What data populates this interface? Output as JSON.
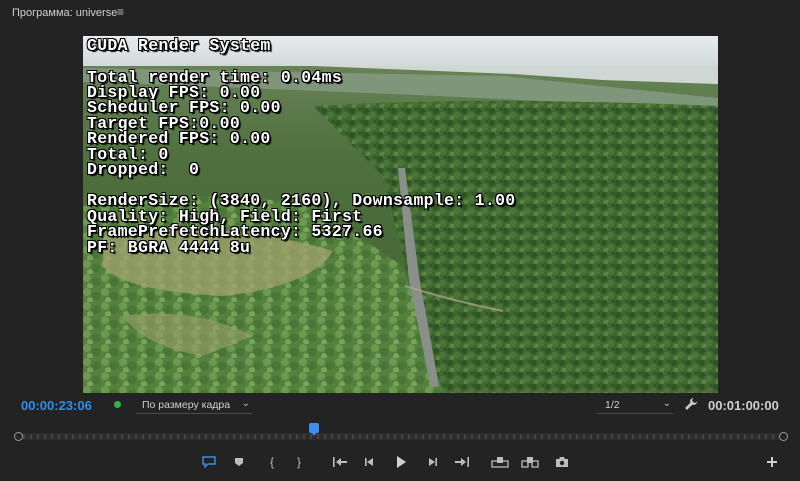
{
  "panel": {
    "title": "Программа: universe",
    "menu_icon": "hamburger-menu-icon"
  },
  "overlay": {
    "lines": [
      "CUDA Render System",
      "Total render time: 0.04ms",
      "Display FPS: 0.00",
      "Scheduler FPS: 0.00",
      "Target FPS:0.00",
      "Rendered FPS: 0.00",
      "Total: 0",
      "Dropped:  0",
      "RenderSize: (3840, 2160), Downsample: 1.00",
      "Quality: High, Field: First",
      "FramePrefetchLatency: 5327.66",
      "PF: BGRA 4444 8u"
    ]
  },
  "controls": {
    "current_time": "00:00:23:06",
    "fit_label": "По размеру кадра",
    "resolution": "1/2",
    "duration": "00:01:00:00"
  },
  "playhead_fraction": 0.385,
  "colors": {
    "accent": "#2e8ee8",
    "background": "#232323",
    "status_green": "#2fb24a"
  },
  "transport": [
    "add-marker-icon",
    "marker-icon",
    "mark-in-icon",
    "mark-out-icon",
    "go-to-in-icon",
    "step-back-icon",
    "play-icon",
    "step-forward-icon",
    "go-to-out-icon",
    "lift-icon",
    "extract-icon",
    "camera-icon",
    "add-button-icon"
  ]
}
